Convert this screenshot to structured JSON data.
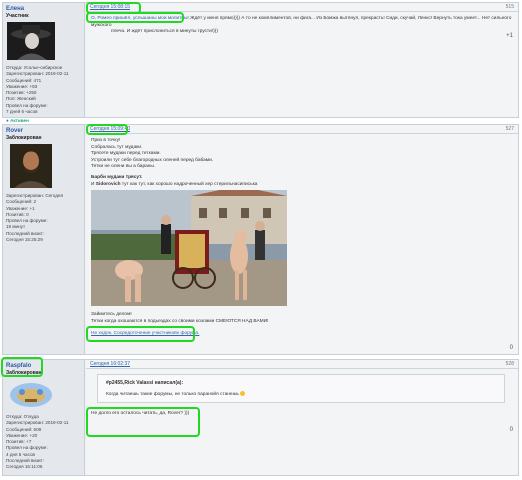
{
  "colors": {
    "highlight": "#22d822",
    "link": "#3366aa",
    "username": "#2a5aa8",
    "sidebar_bg": "#e4e8ed",
    "post_bg": "#f3f4f6"
  },
  "posts": [
    {
      "user": {
        "name": "Елена",
        "rank": "Участник",
        "stats": [
          "Откуда: Усолье-сибирское",
          "Зарегистрирован: 2019-02-11",
          "Сообщений: 471",
          "Уважение: +93",
          "Позитив: +250",
          "Пол: Женский",
          "Провел на форуме:",
          "7 дней 6 часов"
        ],
        "status_icon": "person-icon",
        "status": "Активен"
      },
      "date": "Сегодня 15:08:15",
      "number": "515",
      "lines": [
        "О, Ромео пришёл, услышаны мои молитвы!",
        "Ждёт у меня прямо)))) А то не комплиментов, ни фига... Из Бомжа вытянул, прекрасть! Сиди, скучай, Ленкс! Вернуть тока умеет... Нет сильного мужского",
        "плеча. И ждёт прислониться в минуты грусти!)))"
      ],
      "reputation": "+1"
    },
    {
      "user": {
        "name": "Rover",
        "rank": "Заблокирован",
        "stats": [
          "Зарегистрирован: Сегодня",
          "Сообщений: 2",
          "Уважение: +1",
          "Позитив: 0",
          "Провел на форуме:",
          "19 минут",
          "Последний визит:",
          "Сегодня 15:25:29"
        ]
      },
      "date": "Сегодня 15:09:40",
      "number": "527",
      "lines": [
        "Приз в точку!",
        "Собралась тут мудаки.",
        "Трясете мудаки перед тетками.",
        "Устроили тут себе благородных оленей перед бабами.",
        "Тетки не олени вы а бараны."
      ],
      "bold_line": "Барби мудаки трясут.",
      "mention_pre": "И ",
      "mention_name": "Sidorovich",
      "mention_post": " тут как тут, как хорошо надроченный хер стерильнасиписька",
      "after_image": [
        "Займитесь делом!",
        "Тетки когда охошаются в подьездах со своими козлами СМЕЮТСЯ НАД ВАМИ!"
      ],
      "footer": "Не ходок. Сосредоточение участниковv форума.",
      "reputation": "0"
    },
    {
      "user": {
        "name": "Raspfalo",
        "rank": "Заблокирован",
        "stats": [
          "Откуда: Откуда",
          "Зарегистрирован: 2019-02-11",
          "Сообщений: 509",
          "Уважение: +20",
          "Позитив: +7",
          "Провел на форуме:",
          "4 дня 5 часов",
          "Последний визит:",
          "Сегодня 16:11:06"
        ]
      },
      "date": "Сегодня 16:02:37",
      "number": "528",
      "quote_header": "#p2455,Rick Valassi написал(а):",
      "quote_text": "Когда читаешь такие форумы, не только паранойя станешь",
      "reply": "Не долго его осталось читать, да, Rover? )))",
      "reputation": "0"
    }
  ]
}
